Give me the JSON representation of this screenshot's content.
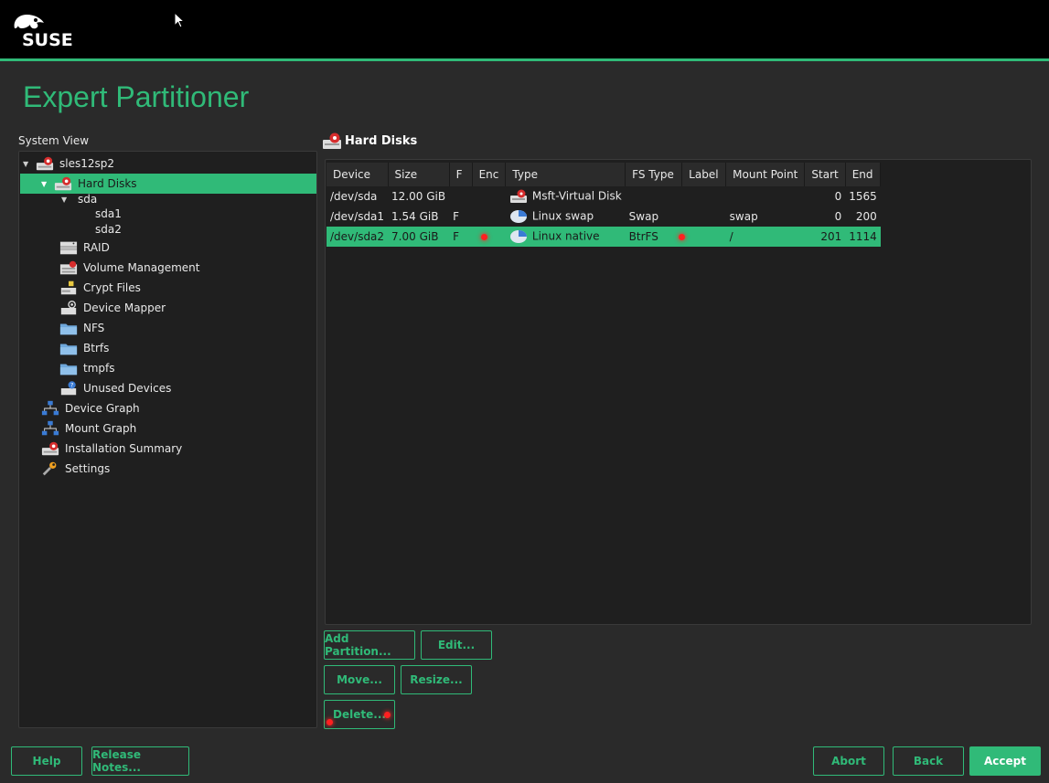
{
  "brand": {
    "name": "SUSE",
    "accent_color": "#30ba78"
  },
  "page": {
    "title": "Expert Partitioner"
  },
  "system_view": {
    "label": "System View",
    "items": [
      {
        "label": "sles12sp2",
        "icon": "hard-disk-icon",
        "expanded": true
      },
      {
        "label": "Hard Disks",
        "icon": "hard-disk-icon",
        "expanded": true,
        "selected": true
      },
      {
        "label": "sda",
        "icon": "",
        "expanded": true
      },
      {
        "label": "sda1",
        "icon": ""
      },
      {
        "label": "sda2",
        "icon": ""
      },
      {
        "label": "RAID",
        "icon": "raid-icon"
      },
      {
        "label": "Volume Management",
        "icon": "volume-management-icon"
      },
      {
        "label": "Crypt Files",
        "icon": "crypt-files-icon"
      },
      {
        "label": "Device Mapper",
        "icon": "device-mapper-icon"
      },
      {
        "label": "NFS",
        "icon": "folder-icon"
      },
      {
        "label": "Btrfs",
        "icon": "folder-icon"
      },
      {
        "label": "tmpfs",
        "icon": "folder-icon"
      },
      {
        "label": "Unused Devices",
        "icon": "unused-devices-icon"
      },
      {
        "label": "Device Graph",
        "icon": "graph-icon"
      },
      {
        "label": "Mount Graph",
        "icon": "graph-icon"
      },
      {
        "label": "Installation Summary",
        "icon": "hard-disk-icon"
      },
      {
        "label": "Settings",
        "icon": "wrench-icon"
      }
    ]
  },
  "main": {
    "section_title": "Hard Disks",
    "columns": [
      "Device",
      "Size",
      "F",
      "Enc",
      "Type",
      "FS Type",
      "Label",
      "Mount Point",
      "Start",
      "End"
    ],
    "rows": [
      {
        "device": "/dev/sda",
        "size": "12.00 GiB",
        "f": "",
        "enc": false,
        "type": "Msft-Virtual Disk",
        "type_icon": "hard-disk-icon",
        "fs_type": "",
        "label_dot": false,
        "mount": "",
        "start": "0",
        "end": "1565"
      },
      {
        "device": "/dev/sda1",
        "size": "1.54 GiB",
        "f": "F",
        "enc": false,
        "type": "Linux swap",
        "type_icon": "partition-icon",
        "fs_type": "Swap",
        "label_dot": false,
        "mount": "swap",
        "start": "0",
        "end": "200"
      },
      {
        "device": "/dev/sda2",
        "size": "7.00 GiB",
        "f": "F",
        "enc": true,
        "type": "Linux native",
        "type_icon": "partition-icon",
        "fs_type": "BtrFS",
        "label_dot": true,
        "mount": "/",
        "start": "201",
        "end": "1114",
        "selected": true
      }
    ]
  },
  "actions": {
    "add_partition": "Add Partition...",
    "edit": "Edit...",
    "move": "Move...",
    "resize": "Resize...",
    "delete": "Delete..."
  },
  "footer": {
    "help": "Help",
    "release_notes": "Release Notes...",
    "abort": "Abort",
    "back": "Back",
    "accept": "Accept"
  }
}
